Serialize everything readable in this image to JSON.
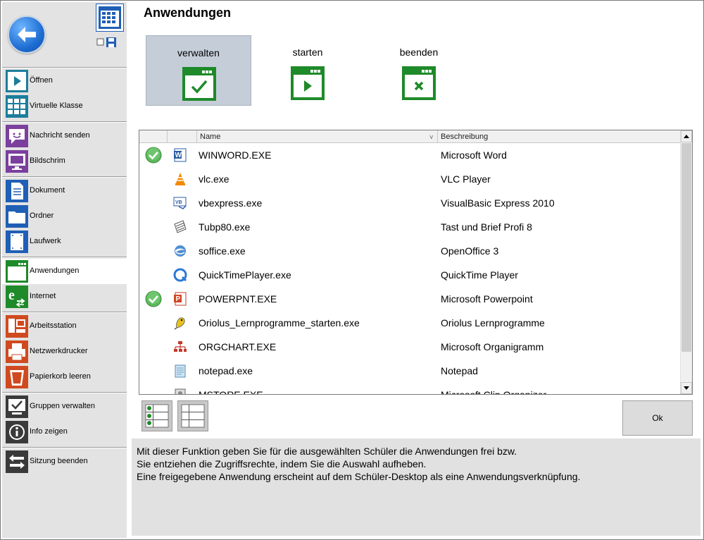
{
  "title": "Anwendungen",
  "sidebar": {
    "items": [
      {
        "label": "Öffnen",
        "icon": "play-grid-icon"
      },
      {
        "label": "Virtuelle Klasse",
        "icon": "class-grid-icon"
      },
      {
        "label": "Nachricht senden",
        "icon": "message-icon"
      },
      {
        "label": "Bildschrim",
        "icon": "monitor-icon"
      },
      {
        "label": "Dokument",
        "icon": "document-icon"
      },
      {
        "label": "Ordner",
        "icon": "folder-icon"
      },
      {
        "label": "Laufwerk",
        "icon": "drive-icon"
      },
      {
        "label": "Anwendungen",
        "icon": "application-window-icon"
      },
      {
        "label": "Internet",
        "icon": "internet-icon"
      },
      {
        "label": "Arbeitsstation",
        "icon": "workstation-icon"
      },
      {
        "label": "Netzwerkdrucker",
        "icon": "printer-icon"
      },
      {
        "label": "Papierkorb leeren",
        "icon": "recycle-bin-icon"
      },
      {
        "label": "Gruppen verwalten",
        "icon": "group-manage-icon"
      },
      {
        "label": "Info zeigen",
        "icon": "info-icon"
      },
      {
        "label": "Sitzung beenden",
        "icon": "end-session-icon"
      }
    ]
  },
  "modes": [
    {
      "label": "verwalten",
      "icon": "window-check-icon",
      "active": true
    },
    {
      "label": "starten",
      "icon": "window-play-icon",
      "active": false
    },
    {
      "label": "beenden",
      "icon": "window-close-icon",
      "active": false
    }
  ],
  "table": {
    "columns": [
      "Name",
      "Beschreibung"
    ],
    "rows": [
      {
        "name": "WINWORD.EXE",
        "desc": "Microsoft Word",
        "checked": true,
        "icon": "word-icon"
      },
      {
        "name": "vlc.exe",
        "desc": "VLC Player",
        "checked": false,
        "icon": "vlc-icon"
      },
      {
        "name": "vbexpress.exe",
        "desc": "VisualBasic Express 2010",
        "checked": false,
        "icon": "vb-icon"
      },
      {
        "name": "Tubp80.exe",
        "desc": "Tast und Brief Profi 8",
        "checked": false,
        "icon": "tubp-icon"
      },
      {
        "name": "soffice.exe",
        "desc": "OpenOffice 3",
        "checked": false,
        "icon": "openoffice-icon"
      },
      {
        "name": "QuickTimePlayer.exe",
        "desc": "QuickTime Player",
        "checked": false,
        "icon": "quicktime-icon"
      },
      {
        "name": "POWERPNT.EXE",
        "desc": "Microsoft Powerpoint",
        "checked": true,
        "icon": "powerpoint-icon"
      },
      {
        "name": "Oriolus_Lernprogramme_starten.exe",
        "desc": "Oriolus Lernprogramme",
        "checked": false,
        "icon": "oriolus-icon"
      },
      {
        "name": "ORGCHART.EXE",
        "desc": "Microsoft Organigramm",
        "checked": false,
        "icon": "orgchart-icon"
      },
      {
        "name": "notepad.exe",
        "desc": "Notepad",
        "checked": false,
        "icon": "notepad-icon"
      },
      {
        "name": "MSTORE.EXE",
        "desc": "Microsoft Clip Organizer",
        "checked": false,
        "icon": "mstore-icon"
      }
    ]
  },
  "ok_label": "Ok",
  "info": {
    "line1": "Mit dieser Funktion geben Sie für die ausgewählten Schüler die Anwendungen frei bzw.",
    "line2": "Sie entziehen die Zugriffsrechte, indem Sie die Auswahl aufheben.",
    "line3": "Eine freigegebene Anwendung erscheint auf dem Schüler-Desktop als eine Anwendungsverknüpfung."
  },
  "colors": {
    "accent_blue": "#1f5fb5",
    "accent_green": "#1e8a2a",
    "active_mode_bg": "#c5ced8",
    "sidebar_bg": "#e3e3e3"
  }
}
